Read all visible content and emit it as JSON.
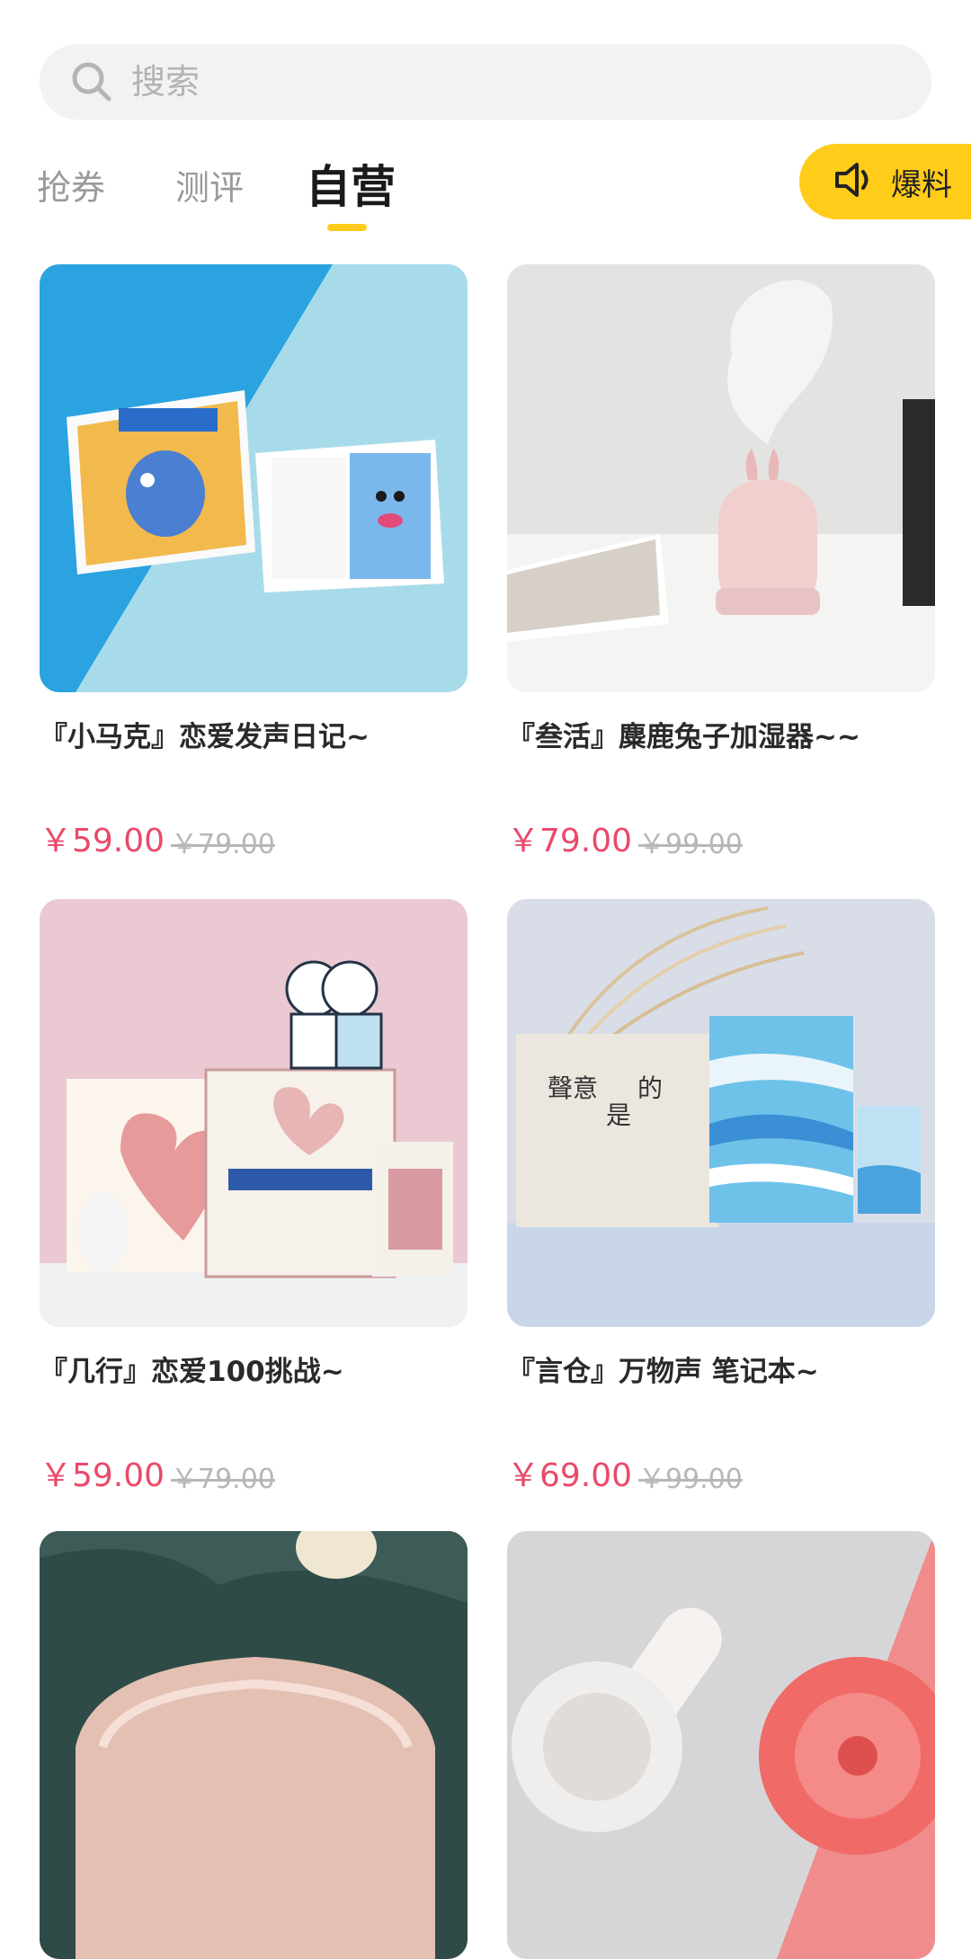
{
  "search": {
    "placeholder": "搜索"
  },
  "tabs": [
    {
      "label": "抢券",
      "active": false
    },
    {
      "label": "测评",
      "active": false
    },
    {
      "label": "自营",
      "active": true
    }
  ],
  "baoliao": {
    "label": "爆料",
    "icon": "speaker-icon"
  },
  "colors": {
    "accent": "#ffcc1a",
    "price": "#e94a6a",
    "old_price": "#b7b7b7"
  },
  "products": [
    {
      "title": "『小马克』恋爱发声日记~",
      "price": "￥59.00",
      "old_price": "￥79.00"
    },
    {
      "title": "『叁活』麋鹿兔子加湿器~~",
      "price": "￥79.00",
      "old_price": "￥99.00"
    },
    {
      "title": "『几行』恋爱100挑战~",
      "price": "￥59.00",
      "old_price": "￥79.00"
    },
    {
      "title": "『言仓』万物声  笔记本~",
      "price": "￥69.00",
      "old_price": "￥99.00"
    },
    {
      "title": "",
      "price": "",
      "old_price": ""
    },
    {
      "title": "",
      "price": "",
      "old_price": ""
    }
  ]
}
